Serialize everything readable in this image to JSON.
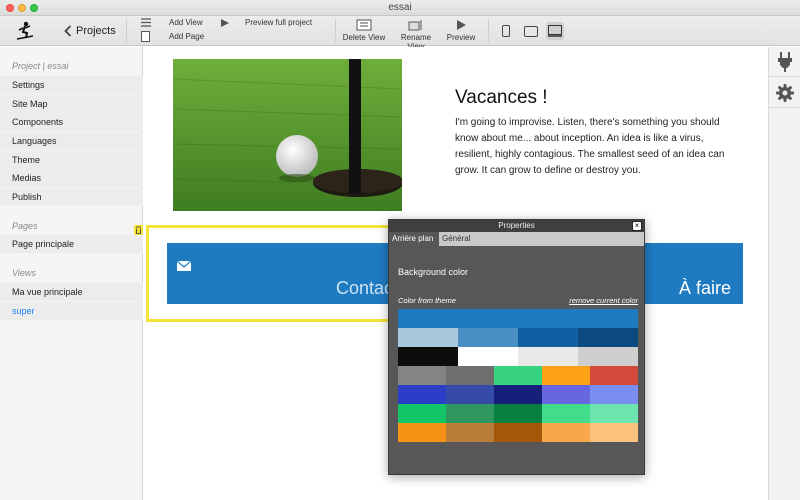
{
  "window": {
    "title": "essai"
  },
  "toolbar": {
    "back_label": "Projects",
    "add_view": "Add View",
    "add_page": "Add Page",
    "preview_full": "Preview full project",
    "delete_view": "Delete View",
    "rename_view": "Rename View",
    "preview": "Preview"
  },
  "sidebar": {
    "project_title": "Project | essai",
    "project_items": [
      "Settings",
      "Site Map",
      "Components",
      "Languages",
      "Theme",
      "Medias",
      "Publish"
    ],
    "pages_title": "Pages",
    "pages_items": [
      "Page principale"
    ],
    "views_title": "Views",
    "views_items": [
      "Ma vue principale",
      "super"
    ]
  },
  "canvas": {
    "heading": "Vacances !",
    "paragraph": "I'm going to improvise. Listen, there's something you should know about me... about inception. An idea is like a virus, resilient, highly contagious. The smallest seed of an idea can grow. It can grow to define or destroy you.",
    "contact_label": "Contacter",
    "todo_label": "À faire"
  },
  "properties": {
    "title": "Properties",
    "close": "×",
    "tabs": [
      "Arrière plan",
      "Général"
    ],
    "bg_title": "Background color",
    "from_theme": "Color from theme",
    "remove_link": "remove current color",
    "theme_primary": "#1f7bc1",
    "row_blues": [
      "#a8c6dc",
      "#4a8fc3",
      "#0f5fa3",
      "#0a4a80"
    ],
    "row_grays": [
      "#0d0d0d",
      "#ffffff",
      "#e9e9e9",
      "#cfcfcf"
    ],
    "palette": [
      [
        "#848484",
        "#6f6f6f",
        "#38d381",
        "#fca214",
        "#d44a3a"
      ],
      [
        "#2b3ec7",
        "#364aa8",
        "#16207a",
        "#6867df",
        "#7a8df0"
      ],
      [
        "#12c566",
        "#2f9660",
        "#078040",
        "#41dd8a",
        "#6ee5ae"
      ],
      [
        "#f69317",
        "#b87d38",
        "#a5580a",
        "#f8a74a",
        "#fac27c"
      ]
    ]
  }
}
